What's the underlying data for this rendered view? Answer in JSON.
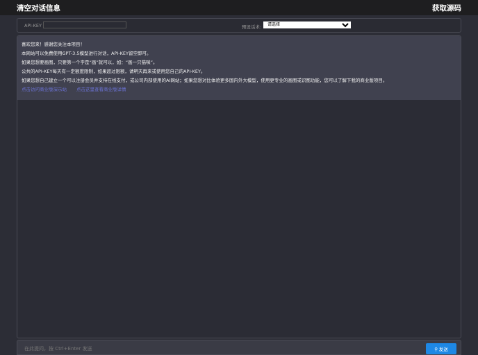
{
  "header": {
    "clear": "清空对话信息",
    "source": "获取源码"
  },
  "config": {
    "api_key_label": "API-KEY",
    "api_key_value": "",
    "preset_label": "预设话术:",
    "preset_selected": "请选择"
  },
  "message": {
    "lines": [
      "喜欢您来！感谢您关注本项目！",
      "本网站可以免费使用GPT-3.5模型进行对话，API-KEY留空即可。",
      "如果您想要画图，只要第一个字是“画”就可以，如：“画一只猫咪”。",
      "公共的API-KEY每天有一定额度限制，如果超过限额，请明天再来或使用您自己的API-KEY。",
      "如果您想自己建立一个可以注册会员并支持在线支付，或公司内部使用的AI网站；如果您想对比体验更多国内外大模型，使用更专业的画图或识图功能，您可以了解下我的商业版项目。"
    ],
    "links": [
      "点击访问商业版演示站",
      "点击这里查看商业版详情"
    ]
  },
  "input": {
    "placeholder": "在此提问，按 Ctrl+Enter 发送",
    "send": "发送"
  }
}
